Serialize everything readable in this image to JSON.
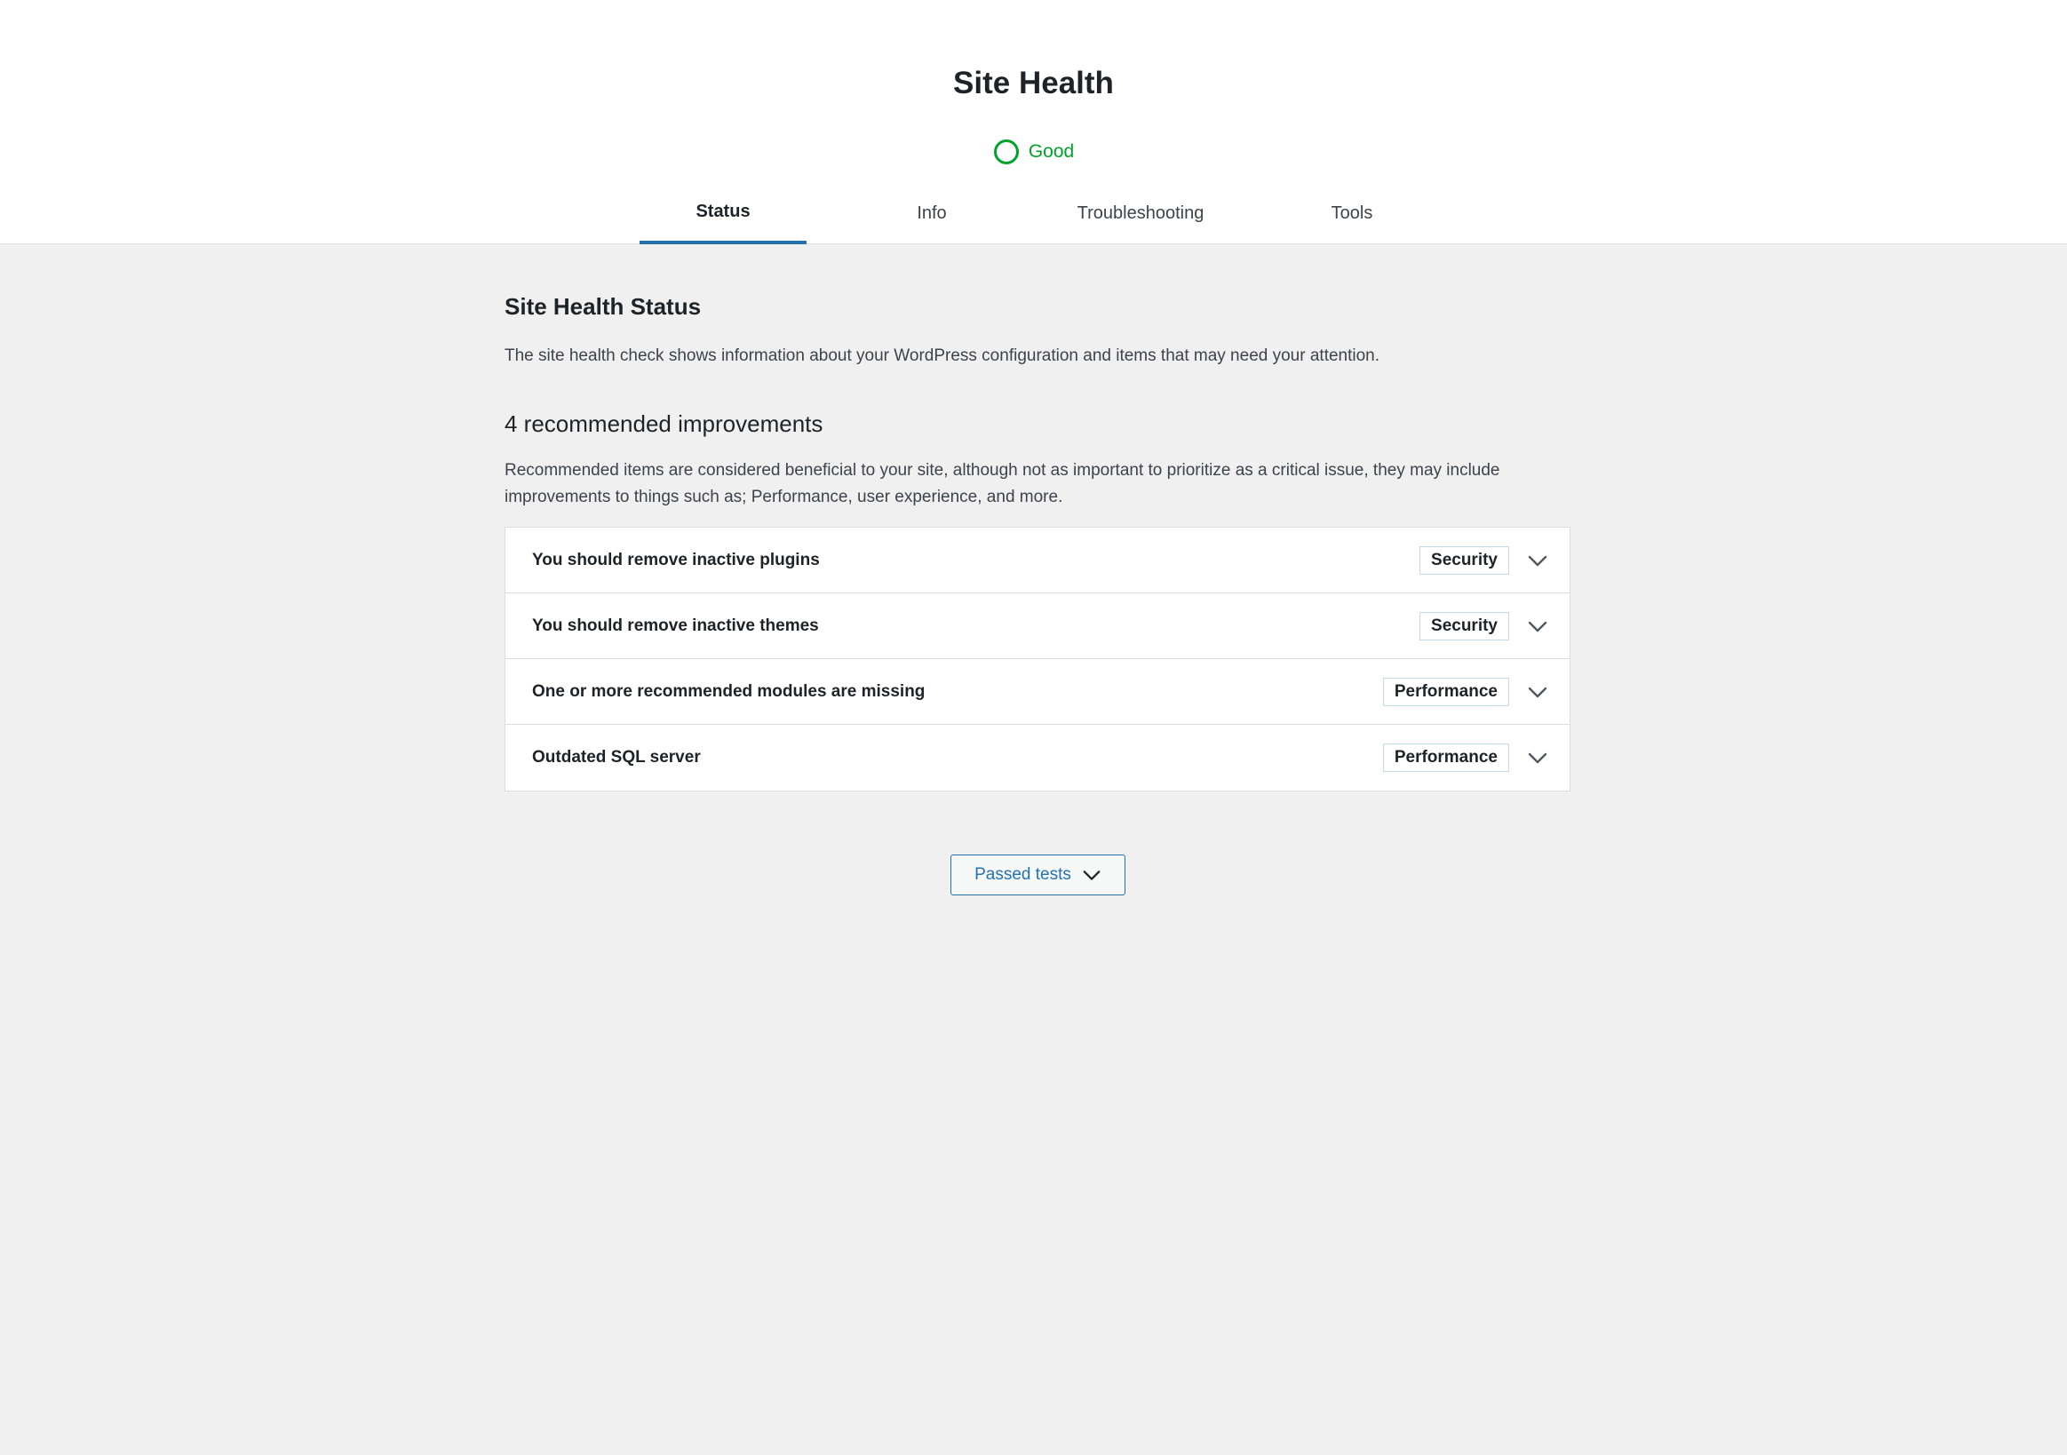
{
  "header": {
    "title": "Site Health",
    "status_label": "Good",
    "status_color": "#00a32a"
  },
  "tabs": [
    {
      "label": "Status",
      "active": true
    },
    {
      "label": "Info",
      "active": false
    },
    {
      "label": "Troubleshooting",
      "active": false
    },
    {
      "label": "Tools",
      "active": false
    }
  ],
  "main": {
    "section_title": "Site Health Status",
    "section_description": "The site health check shows information about your WordPress configuration and items that may need your attention.",
    "improvements_title": "4 recommended improvements",
    "improvements_description": "Recommended items are considered beneficial to your site, although not as important to prioritize as a critical issue, they may include improvements to things such as; Performance, user experience, and more.",
    "items": [
      {
        "title": "You should remove inactive plugins",
        "badge": "Security"
      },
      {
        "title": "You should remove inactive themes",
        "badge": "Security"
      },
      {
        "title": "One or more recommended modules are missing",
        "badge": "Performance"
      },
      {
        "title": "Outdated SQL server",
        "badge": "Performance"
      }
    ],
    "passed_tests_label": "Passed tests"
  },
  "colors": {
    "accent": "#2271b1",
    "good": "#00a32a",
    "background": "#f0f0f1"
  }
}
